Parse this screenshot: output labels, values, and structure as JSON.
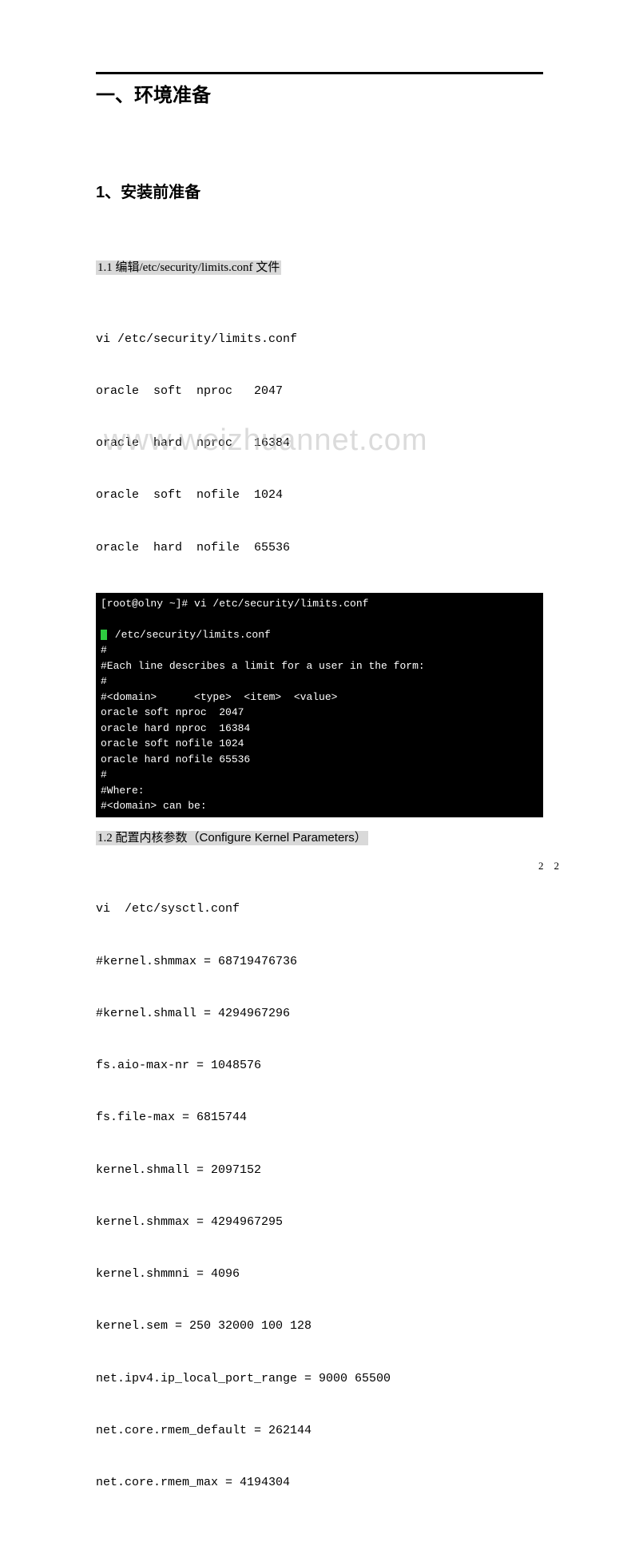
{
  "heading1": "一、环境准备",
  "heading2": "1、安装前准备",
  "section11": {
    "title": "1.1 编辑/etc/security/limits.conf 文件",
    "lines": [
      "vi /etc/security/limits.conf",
      "oracle  soft  nproc   2047",
      "oracle  hard  nproc   16384",
      "oracle  soft  nofile  1024",
      "oracle  hard  nofile  65536"
    ]
  },
  "terminal": {
    "prompt_user": "[root@olny ~]#",
    "prompt_cmd": " vi /etc/security/limits.conf",
    "file_header": " /etc/security/limits.conf",
    "hash": "#",
    "desc": "#Each line describes a limit for a user in the form:",
    "columns": "#<domain>      <type>  <item>  <value>",
    "rows": [
      "oracle soft nproc  2047",
      "oracle hard nproc  16384",
      "oracle soft nofile 1024",
      "oracle hard nofile 65536"
    ],
    "where": "#Where:",
    "domain_can_be": "#<domain> can be:"
  },
  "section12": {
    "title_cn": "1.2 配置内核参数（",
    "title_en": "Configure Kernel Parameters",
    "title_close": "）",
    "lines": [
      "vi  /etc/sysctl.conf",
      "#kernel.shmmax = 68719476736",
      "#kernel.shmall = 4294967296",
      "fs.aio-max-nr = 1048576",
      "fs.file-max = 6815744",
      "kernel.shmall = 2097152",
      "kernel.shmmax = 4294967295",
      "kernel.shmmni = 4096",
      "kernel.sem = 250 32000 100 128",
      "net.ipv4.ip_local_port_range = 9000 65500",
      "net.core.rmem_default = 262144",
      "net.core.rmem_max = 4194304"
    ]
  },
  "watermark": "www.weizhuannet.com",
  "footer_left": "2",
  "footer_right": "2"
}
